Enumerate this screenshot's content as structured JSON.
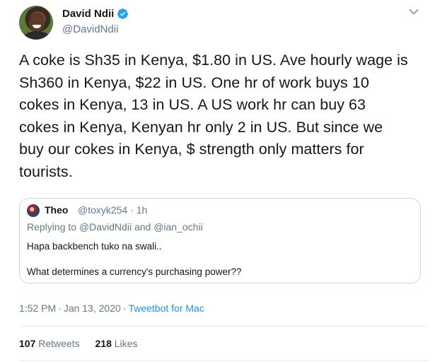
{
  "author": {
    "name": "David Ndii",
    "handle": "@DavidNdii",
    "verified": true,
    "avatar_icon": "profile-photo"
  },
  "tweet": {
    "text": "A coke is Sh35 in Kenya, $1.80 in US. Ave hourly wage is\nSh360 in Kenya,  $22 in US. One hr of work buys 10\ncokes in Kenya, 13 in US. A US work hr can buy 63\ncokes in Kenya, Kenyan hr only 2 in US. But since we\nbuy our cokes in Kenya, $ strength only matters for\ntourists.",
    "time": "1:52 PM",
    "date": "Jan 13, 2020",
    "separator": "·",
    "source": "Tweetbot for Mac"
  },
  "quoted": {
    "name": "Theo",
    "handle": "@toxyk254",
    "separator": "·",
    "age": "1h",
    "replying_to": "Replying to @DavidNdii and @ian_ochii",
    "line1": "Hapa backbench tuko na swali..",
    "line2": "What determines a currency's purchasing power??"
  },
  "stats": {
    "retweets_count": "107",
    "retweets_label": "Retweets",
    "likes_count": "218",
    "likes_label": "Likes"
  },
  "colors": {
    "text": "#14171a",
    "muted": "#657786",
    "link": "#1b95e0",
    "verified": "#1da1f2",
    "border": "#ccd6dd"
  },
  "icons": {
    "verified": "verified-badge-icon",
    "menu": "chevron-down-icon"
  }
}
